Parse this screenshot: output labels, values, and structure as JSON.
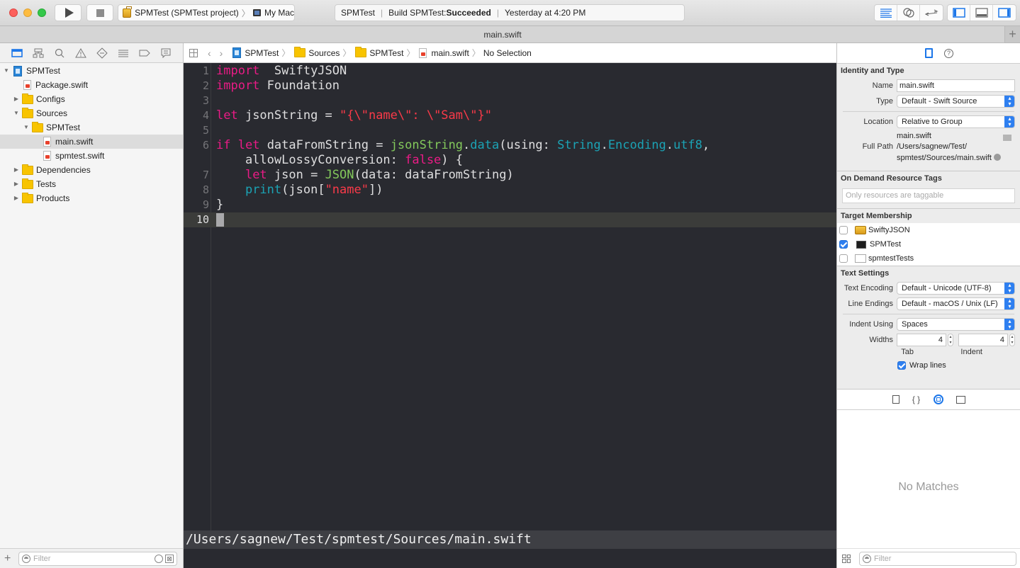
{
  "toolbar": {
    "scheme_target": "SPMTest (SPMTest project)",
    "scheme_device": "My Mac",
    "activity_project": "SPMTest",
    "activity_status_prefix": "Build SPMTest: ",
    "activity_status_result": "Succeeded",
    "activity_time": "Yesterday at 4:20 PM"
  },
  "tab": {
    "title": "main.swift",
    "add_label": "+"
  },
  "navigator": {
    "tree": [
      {
        "label": "SPMTest",
        "kind": "project",
        "depth": 0,
        "expanded": true
      },
      {
        "label": "Package.swift",
        "kind": "swift",
        "depth": 1
      },
      {
        "label": "Configs",
        "kind": "folder",
        "depth": 1,
        "expanded": false
      },
      {
        "label": "Sources",
        "kind": "folder",
        "depth": 1,
        "expanded": true
      },
      {
        "label": "SPMTest",
        "kind": "folder",
        "depth": 2,
        "expanded": true
      },
      {
        "label": "main.swift",
        "kind": "swift",
        "depth": 3,
        "selected": true
      },
      {
        "label": "spmtest.swift",
        "kind": "swift",
        "depth": 3
      },
      {
        "label": "Dependencies",
        "kind": "folder",
        "depth": 1,
        "expanded": false
      },
      {
        "label": "Tests",
        "kind": "folder",
        "depth": 1,
        "expanded": false
      },
      {
        "label": "Products",
        "kind": "folder",
        "depth": 1,
        "expanded": false
      }
    ],
    "filter_placeholder": "Filter"
  },
  "jumpbar": {
    "crumbs": [
      "SPMTest",
      "Sources",
      "SPMTest",
      "main.swift",
      "No Selection"
    ]
  },
  "editor": {
    "lines": [
      {
        "num": "1",
        "tokens": [
          [
            "kw",
            "import"
          ],
          [
            "",
            "  SwiftyJSON"
          ]
        ]
      },
      {
        "num": "2",
        "tokens": [
          [
            "kw",
            "import"
          ],
          [
            "",
            " Foundation"
          ]
        ]
      },
      {
        "num": "3",
        "tokens": []
      },
      {
        "num": "4",
        "tokens": [
          [
            "kw",
            "let"
          ],
          [
            "",
            " jsonString = "
          ],
          [
            "str",
            "\"{\\\"name\\\": \\\"Sam\\\"}\""
          ]
        ]
      },
      {
        "num": "5",
        "tokens": []
      },
      {
        "num": "6",
        "tokens": [
          [
            "kw",
            "if"
          ],
          [
            "",
            " "
          ],
          [
            "kw",
            "let"
          ],
          [
            "",
            " dataFromString = "
          ],
          [
            "ty",
            "jsonString"
          ],
          [
            "",
            "."
          ],
          [
            "fn",
            "data"
          ],
          [
            "",
            "(using: "
          ],
          [
            "fn",
            "String"
          ],
          [
            "",
            "."
          ],
          [
            "fn",
            "Encoding"
          ],
          [
            "",
            "."
          ],
          [
            "fn",
            "utf8"
          ],
          [
            "",
            ","
          ]
        ]
      },
      {
        "num": "",
        "tokens": [
          [
            "",
            "    allowLossyConversion: "
          ],
          [
            "kw",
            "false"
          ],
          [
            "",
            ") {"
          ]
        ]
      },
      {
        "num": "7",
        "tokens": [
          [
            "",
            "    "
          ],
          [
            "kw",
            "let"
          ],
          [
            "",
            " json = "
          ],
          [
            "ty",
            "JSON"
          ],
          [
            "",
            "(data: dataFromString)"
          ]
        ]
      },
      {
        "num": "8",
        "tokens": [
          [
            "",
            "    "
          ],
          [
            "fn",
            "print"
          ],
          [
            "",
            "(json["
          ],
          [
            "str",
            "\"name\""
          ],
          [
            "",
            "])"
          ]
        ]
      },
      {
        "num": "9",
        "tokens": [
          [
            "",
            "}"
          ]
        ]
      },
      {
        "num": "10",
        "tokens": [],
        "current": true
      }
    ],
    "console_path": "/Users/sagnew/Test/spmtest/Sources/main.swift"
  },
  "inspector": {
    "identity": {
      "header": "Identity and Type",
      "name_label": "Name",
      "name_value": "main.swift",
      "type_label": "Type",
      "type_value": "Default - Swift Source",
      "location_label": "Location",
      "location_value": "Relative to Group",
      "location_file": "main.swift",
      "fullpath_label": "Full Path",
      "fullpath_line1": "/Users/sagnew/Test/",
      "fullpath_line2": "spmtest/Sources/main.swift"
    },
    "tags": {
      "header": "On Demand Resource Tags",
      "placeholder": "Only resources are taggable"
    },
    "membership": {
      "header": "Target Membership",
      "targets": [
        {
          "label": "SwiftyJSON",
          "checked": false,
          "icon": "framework"
        },
        {
          "label": "SPMTest",
          "checked": true,
          "icon": "terminal"
        },
        {
          "label": "spmtestTests",
          "checked": false,
          "icon": "bundle"
        }
      ]
    },
    "text_settings": {
      "header": "Text Settings",
      "encoding_label": "Text Encoding",
      "encoding_value": "Default - Unicode (UTF-8)",
      "endings_label": "Line Endings",
      "endings_value": "Default - macOS / Unix (LF)",
      "indent_label": "Indent Using",
      "indent_value": "Spaces",
      "widths_label": "Widths",
      "tab_value": "4",
      "indent_width_value": "4",
      "tab_caption": "Tab",
      "indent_caption": "Indent",
      "wrap_label": "Wrap lines",
      "wrap_checked": true
    },
    "library": {
      "empty_text": "No Matches",
      "filter_placeholder": "Filter"
    }
  }
}
